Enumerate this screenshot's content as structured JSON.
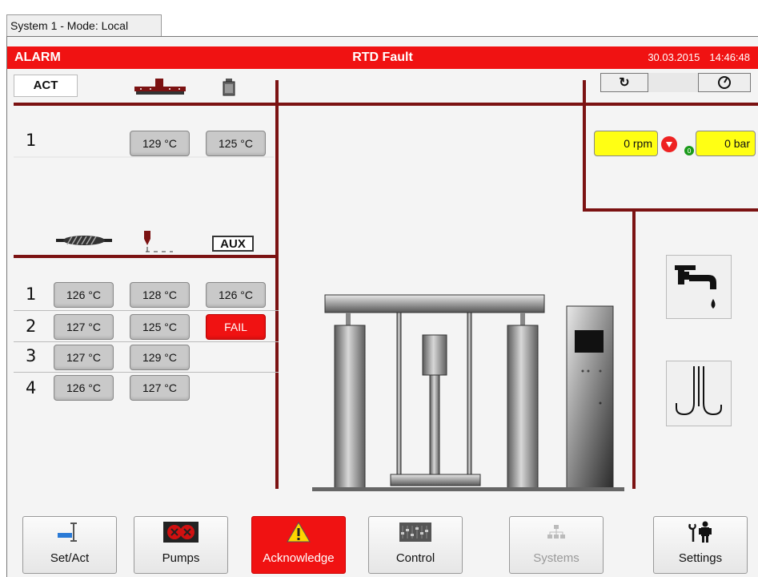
{
  "tab": {
    "label": "System 1 - Mode: Local"
  },
  "alarm": {
    "label": "ALARM",
    "message": "RTD Fault",
    "date": "30.03.2015",
    "time": "14:46:48",
    "color": "#f01212"
  },
  "left": {
    "act_label": "ACT",
    "top_row": {
      "number": "1",
      "values": [
        "129 °C",
        "125 °C"
      ]
    },
    "aux_label": "AUX",
    "rows": [
      {
        "number": "1",
        "values": [
          "126 °C",
          "128 °C",
          "126 °C"
        ]
      },
      {
        "number": "2",
        "values": [
          "127 °C",
          "125 °C",
          "FAIL"
        ]
      },
      {
        "number": "3",
        "values": [
          "127 °C",
          "129 °C"
        ]
      },
      {
        "number": "4",
        "values": [
          "126 °C",
          "127 °C"
        ]
      }
    ]
  },
  "right": {
    "rpm": "0 rpm",
    "bar": "0 bar",
    "icons": [
      "refresh-icon",
      "gauge-icon",
      "alarm-down-icon",
      "status-green-icon",
      "water-tap-icon",
      "heater-coil-icon"
    ]
  },
  "bottom": {
    "buttons": [
      {
        "label": "Set/Act",
        "icon": "set-act-icon"
      },
      {
        "label": "Pumps",
        "icon": "pumps-icon"
      },
      {
        "label": "Acknowledge",
        "icon": "warning-icon",
        "active": true
      },
      {
        "label": "Control",
        "icon": "control-icon"
      },
      {
        "label": "Systems",
        "icon": "systems-icon",
        "disabled": true
      },
      {
        "label": "Settings",
        "icon": "settings-icon"
      }
    ]
  }
}
